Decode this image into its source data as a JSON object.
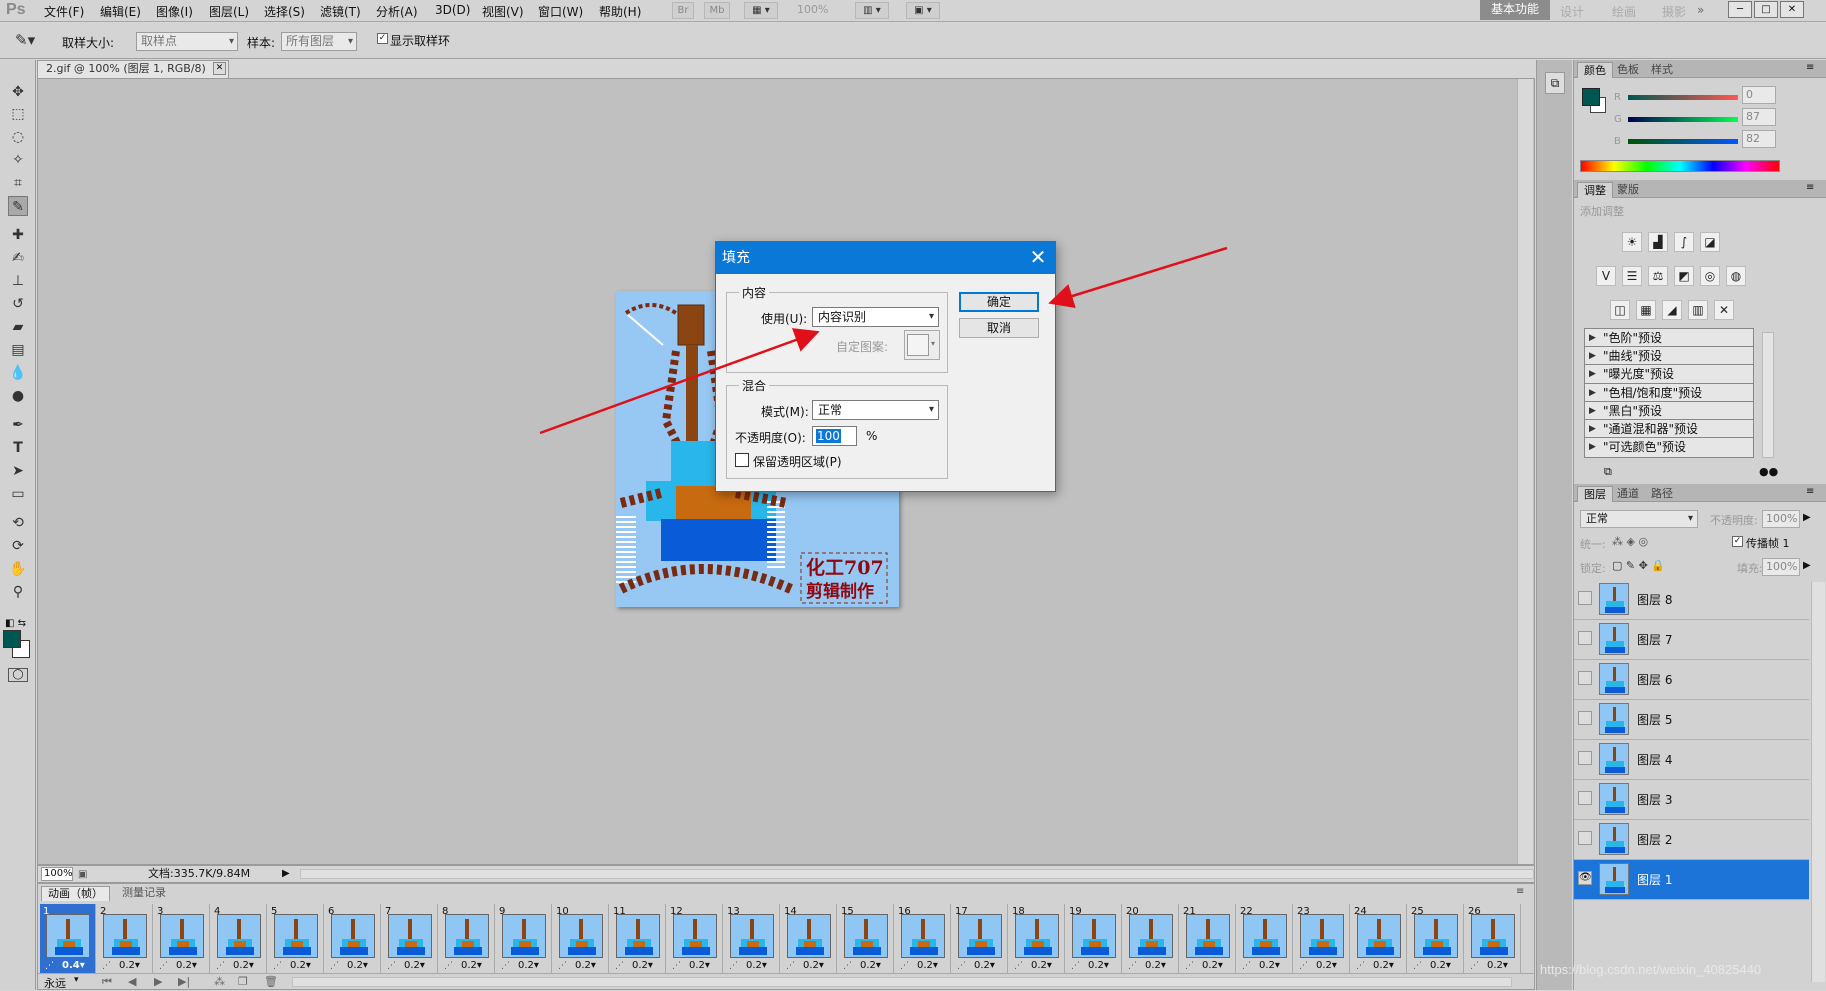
{
  "app": {
    "logo": "Ps",
    "menu": [
      "文件(F)",
      "编辑(E)",
      "图像(I)",
      "图层(L)",
      "选择(S)",
      "滤镜(T)",
      "分析(A)",
      "3D(D)",
      "视图(V)",
      "窗口(W)",
      "帮助(H)"
    ],
    "toolbar_buttons": [
      "Br",
      "Mb"
    ],
    "zoom_display": "100%",
    "workspaces": {
      "active": "基本功能",
      "others": [
        "设计",
        "绘画",
        "摄影"
      ],
      "more": "»"
    },
    "window_buttons": [
      "─",
      "□",
      "✕"
    ]
  },
  "options_bar": {
    "sample_size_label": "取样大小:",
    "sample_size_value": "取样点",
    "sample_label": "样本:",
    "sample_value": "所有图层",
    "show_ring_label": "显示取样环",
    "show_ring_checked": true
  },
  "document": {
    "tab_title": "2.gif @ 100% (图层 1, RGB/8)",
    "zoom": "100%",
    "file_info": "文档:335.7K/9.84M",
    "image_text_line1": "化工707",
    "image_text_line2": "剪辑制作"
  },
  "fill_dialog": {
    "title": "填充",
    "content_group": "内容",
    "use_label": "使用(U):",
    "use_value": "内容识别",
    "custom_pattern_label": "自定图案:",
    "blend_group": "混合",
    "mode_label": "模式(M):",
    "mode_value": "正常",
    "opacity_label": "不透明度(O):",
    "opacity_value": "100",
    "opacity_unit": "%",
    "preserve_label": "保留透明区域(P)",
    "preserve_checked": false,
    "ok_label": "确定",
    "cancel_label": "取消"
  },
  "color_panel": {
    "tabs": [
      "颜色",
      "色板",
      "样式"
    ],
    "foreground": "#005752",
    "r": "0",
    "g": "87",
    "b": "82",
    "r_label": "R",
    "g_label": "G",
    "b_label": "B"
  },
  "adjustments_panel": {
    "tabs": [
      "调整",
      "蒙版"
    ],
    "header": "添加调整",
    "presets": [
      "\"色阶\"预设",
      "\"曲线\"预设",
      "\"曝光度\"预设",
      "\"色相/饱和度\"预设",
      "\"黑白\"预设",
      "\"通道混和器\"预设",
      "\"可选颜色\"预设"
    ]
  },
  "layers_panel": {
    "tabs": [
      "图层",
      "通道",
      "路径"
    ],
    "blend_mode": "正常",
    "opacity_label": "不透明度:",
    "opacity_value": "100%",
    "unify_label": "统一:",
    "propagate_label": "传播帧 1",
    "lock_label": "锁定:",
    "fill_label": "填充:",
    "fill_value": "100%",
    "layers": [
      "图层 8",
      "图层 7",
      "图层 6",
      "图层 5",
      "图层 4",
      "图层 3",
      "图层 2",
      "图层 1"
    ],
    "selected": "图层 1"
  },
  "animation_panel": {
    "tabs": [
      "动画（帧）",
      "测量记录"
    ],
    "loop": "永远",
    "frames": [
      {
        "n": "1",
        "d": "0.4▾"
      },
      {
        "n": "2",
        "d": "0.2▾"
      },
      {
        "n": "3",
        "d": "0.2▾"
      },
      {
        "n": "4",
        "d": "0.2▾"
      },
      {
        "n": "5",
        "d": "0.2▾"
      },
      {
        "n": "6",
        "d": "0.2▾"
      },
      {
        "n": "7",
        "d": "0.2▾"
      },
      {
        "n": "8",
        "d": "0.2▾"
      },
      {
        "n": "9",
        "d": "0.2▾"
      },
      {
        "n": "10",
        "d": "0.2▾"
      },
      {
        "n": "11",
        "d": "0.2▾"
      },
      {
        "n": "12",
        "d": "0.2▾"
      },
      {
        "n": "13",
        "d": "0.2▾"
      },
      {
        "n": "14",
        "d": "0.2▾"
      },
      {
        "n": "15",
        "d": "0.2▾"
      },
      {
        "n": "16",
        "d": "0.2▾"
      },
      {
        "n": "17",
        "d": "0.2▾"
      },
      {
        "n": "18",
        "d": "0.2▾"
      },
      {
        "n": "19",
        "d": "0.2▾"
      },
      {
        "n": "20",
        "d": "0.2▾"
      },
      {
        "n": "21",
        "d": "0.2▾"
      },
      {
        "n": "22",
        "d": "0.2▾"
      },
      {
        "n": "23",
        "d": "0.2▾"
      },
      {
        "n": "24",
        "d": "0.2▾"
      },
      {
        "n": "25",
        "d": "0.2▾"
      },
      {
        "n": "26",
        "d": "0.2▾"
      }
    ]
  },
  "watermark": "https://blog.csdn.net/weixin_40825440",
  "accent_colors": {
    "arrow": "#e0101a",
    "title_bar": "#0a78d7",
    "selection": "#1c74d9"
  }
}
